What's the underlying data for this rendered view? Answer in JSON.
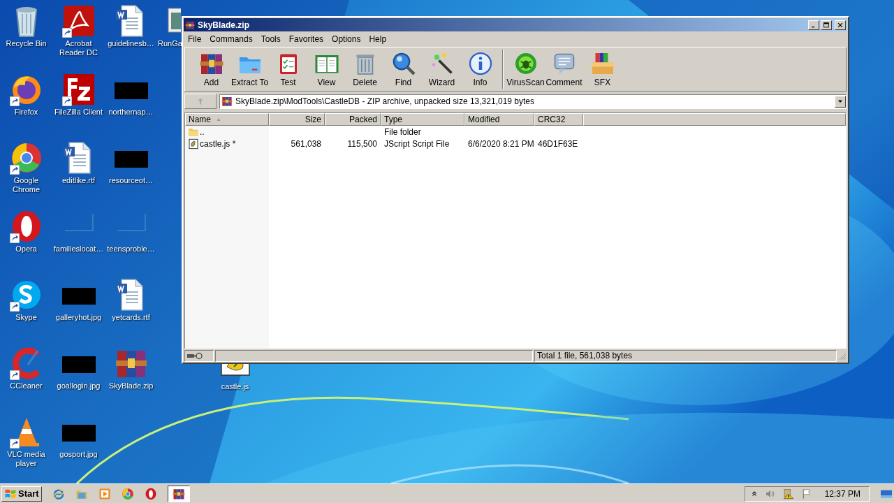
{
  "desktop": {
    "icons": [
      {
        "label": "Recycle Bin",
        "kind": "recycle",
        "shortcut": false
      },
      {
        "label": "Firefox",
        "kind": "firefox",
        "shortcut": true
      },
      {
        "label": "Google Chrome",
        "kind": "chrome",
        "shortcut": true
      },
      {
        "label": "Opera",
        "kind": "opera",
        "shortcut": true
      },
      {
        "label": "Skype",
        "kind": "skype",
        "shortcut": true
      },
      {
        "label": "CCleaner",
        "kind": "ccleaner",
        "shortcut": true
      },
      {
        "label": "VLC media player",
        "kind": "vlc",
        "shortcut": true
      },
      {
        "label": "Acrobat Reader DC",
        "kind": "pdf",
        "shortcut": true
      },
      {
        "label": "FileZilla Client",
        "kind": "filezilla",
        "shortcut": true
      },
      {
        "label": "editlike.rtf",
        "kind": "word",
        "shortcut": false
      },
      {
        "label": "familieslocat…",
        "kind": "blank",
        "shortcut": false
      },
      {
        "label": "galleryhot.jpg",
        "kind": "redacted",
        "shortcut": false
      },
      {
        "label": "goallogin.jpg",
        "kind": "redacted",
        "shortcut": false
      },
      {
        "label": "gosport.jpg",
        "kind": "redacted",
        "shortcut": false
      },
      {
        "label": "guidelinesb…",
        "kind": "word",
        "shortcut": false
      },
      {
        "label": "northernap…",
        "kind": "redacted",
        "shortcut": false
      },
      {
        "label": "resourceot…",
        "kind": "redacted",
        "shortcut": false
      },
      {
        "label": "teensproble…",
        "kind": "blank",
        "shortcut": false
      },
      {
        "label": "yetcards.rtf",
        "kind": "word",
        "shortcut": false
      },
      {
        "label": "SkyBlade.zip",
        "kind": "winrar",
        "shortcut": false
      }
    ],
    "icons_behind_window": [
      {
        "label": "RunGa",
        "kind": "app",
        "shortcut": false
      },
      {
        "label": "castle.js",
        "kind": "script",
        "shortcut": false
      }
    ]
  },
  "window": {
    "title": "SkyBlade.zip",
    "menu": [
      "File",
      "Commands",
      "Tools",
      "Favorites",
      "Options",
      "Help"
    ],
    "toolbar": [
      {
        "label": "Add",
        "kind": "add"
      },
      {
        "label": "Extract To",
        "kind": "extract"
      },
      {
        "label": "Test",
        "kind": "test"
      },
      {
        "label": "View",
        "kind": "view"
      },
      {
        "label": "Delete",
        "kind": "delete"
      },
      {
        "label": "Find",
        "kind": "find"
      },
      {
        "label": "Wizard",
        "kind": "wizard"
      },
      {
        "label": "Info",
        "kind": "info"
      },
      {
        "label": "VirusScan",
        "kind": "virus",
        "separator_before": true
      },
      {
        "label": "Comment",
        "kind": "comment"
      },
      {
        "label": "SFX",
        "kind": "sfx"
      }
    ],
    "address": "SkyBlade.zip\\ModTools\\CastleDB - ZIP archive, unpacked size 13,321,019 bytes",
    "table": {
      "columns": [
        {
          "label": "Name",
          "sorted": true
        },
        {
          "label": "Size",
          "sorted": false
        },
        {
          "label": "Packed",
          "sorted": false
        },
        {
          "label": "Type",
          "sorted": false
        },
        {
          "label": "Modified",
          "sorted": false
        },
        {
          "label": "CRC32",
          "sorted": false
        }
      ],
      "rows": [
        {
          "kind": "folder",
          "cells": [
            "..",
            "",
            "",
            "File folder",
            "",
            ""
          ]
        },
        {
          "kind": "script",
          "cells": [
            "castle.js *",
            "561,038",
            "115,500",
            "JScript Script File",
            "6/6/2020 8:21 PM",
            "46D1F63E"
          ]
        }
      ]
    },
    "status_bar": "Total 1 file, 561,038 bytes"
  },
  "taskbar": {
    "start": "Start",
    "quick_launch": [
      {
        "kind": "ie"
      },
      {
        "kind": "explorer"
      },
      {
        "kind": "media"
      },
      {
        "kind": "chrome"
      },
      {
        "kind": "opera"
      }
    ],
    "tasks": [
      {
        "kind": "winrar",
        "selected": true
      }
    ],
    "clock": "12:37 PM"
  }
}
